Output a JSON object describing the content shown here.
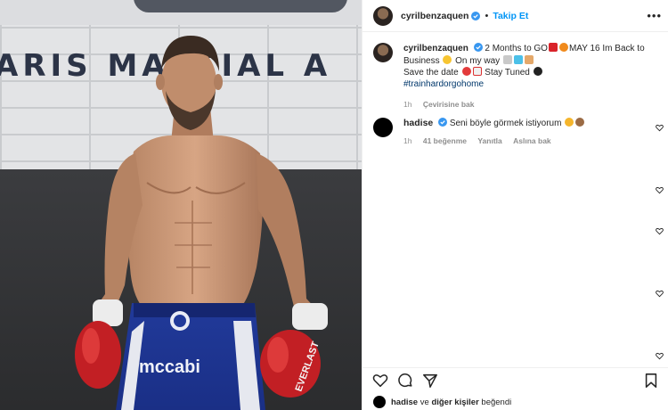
{
  "post": {
    "username": "cyrilbenzaquen",
    "follow_label": "Takip Et",
    "more_label": "•••",
    "separator": "•"
  },
  "photo": {
    "wall_text": "ARIS MARTIAL A",
    "shorts_brand": "mccabi",
    "glove_brand": "EVERLAST"
  },
  "caption": {
    "username": "cyrilbenzaquen",
    "line1_a": "2 Months to GO",
    "line1_b": "MAY 16 Im Back to",
    "line2_a": "Business",
    "line2_b": "On my way",
    "line3_a": "Save the date",
    "line3_b": "Stay Tuned",
    "hashtag": "#trainhardorgohome",
    "time": "1h",
    "translate_label": "Çevirisine bak"
  },
  "comment": {
    "username": "hadise",
    "text": "Seni böyle görmek istiyorum",
    "time": "1h",
    "likes": "41 beğenme",
    "reply_label": "Yanıtla",
    "translate_label": "Aslına bak"
  },
  "likes_line": {
    "username": "hadise",
    "text": "ve",
    "others_label": "diğer kişiler",
    "suffix": "beğendi"
  },
  "colors": {
    "link_blue": "#0095f6",
    "verified_blue": "#3897f0",
    "hashtag": "#00376b",
    "muted": "#8e8e8e"
  },
  "icons": [
    "verified-icon",
    "heart-icon",
    "comment-icon",
    "share-icon",
    "bookmark-icon",
    "more-icon"
  ]
}
